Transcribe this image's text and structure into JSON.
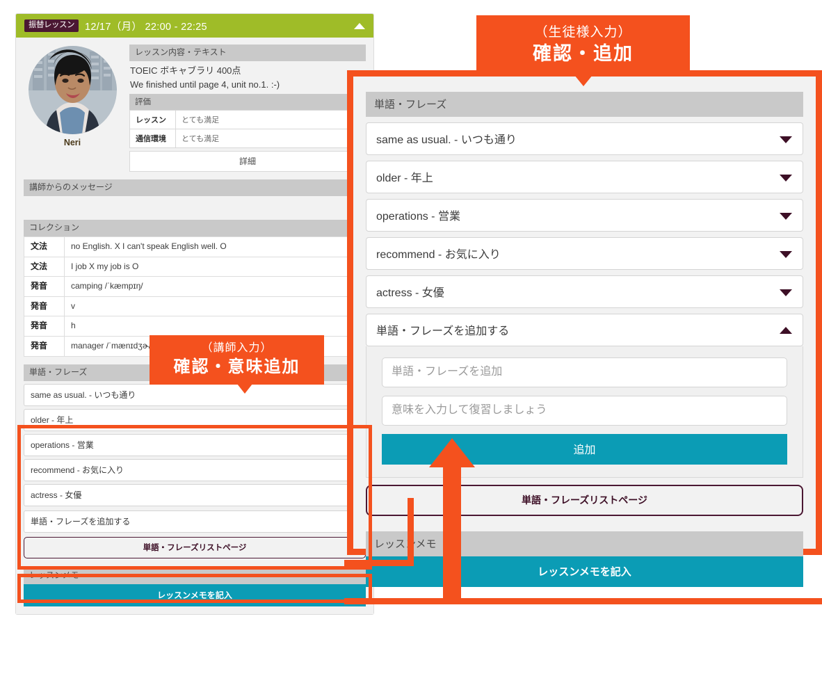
{
  "lesson_card": {
    "header": {
      "badge": "振替レッスン",
      "datetime": "12/17（月） 22:00 - 22:25",
      "collapse_icon": "caret-up-icon"
    },
    "teacher": {
      "name": "Neri",
      "avatar_icon": "teacher-avatar"
    },
    "lesson_content": {
      "section_title": "レッスン内容・テキスト",
      "line1": "TOEIC ボキャブラリ 400点",
      "line2": "We finished until page 4, unit no.1. :-)"
    },
    "evaluation": {
      "section_title": "評価",
      "rows": [
        {
          "label": "レッスン",
          "value": "とても満足"
        },
        {
          "label": "通信環境",
          "value": "とても満足"
        }
      ],
      "detail_button": "詳細"
    },
    "teacher_message": {
      "section_title": "講師からのメッセージ",
      "body": ""
    },
    "collection": {
      "section_title": "コレクション",
      "rows": [
        {
          "category": "文法",
          "text": "no English. X I can't speak English well. O"
        },
        {
          "category": "文法",
          "text": "I job X my job is O"
        },
        {
          "category": "発音",
          "text": "camping /ˈkæmpɪŋ/"
        },
        {
          "category": "発音",
          "text": "v"
        },
        {
          "category": "発音",
          "text": "h"
        },
        {
          "category": "発音",
          "text": "manager /ˈmænɪdʒɚ/"
        }
      ]
    },
    "words": {
      "section_title": "単語・フレーズ",
      "items": [
        "same as usual. - いつも通り",
        "older - 年上",
        "operations - 営業",
        "recommend - お気に入り",
        "actress - 女優"
      ],
      "add_toggle": "単語・フレーズを追加する",
      "list_page_button": "単語・フレーズリストページ"
    },
    "memo": {
      "section_title": "レッスンメモ",
      "button": "レッスンメモを記入"
    }
  },
  "detail_panel": {
    "words": {
      "section_title": "単語・フレーズ",
      "items": [
        "same as usual. - いつも通り",
        "older - 年上",
        "operations - 営業",
        "recommend - お気に入り",
        "actress - 女優"
      ],
      "add_toggle": "単語・フレーズを追加する",
      "add_form": {
        "word_placeholder": "単語・フレーズを追加",
        "word_value": "",
        "meaning_placeholder": "意味を入力して復習しましょう",
        "meaning_value": "",
        "submit_button": "追加"
      },
      "list_page_button": "単語・フレーズリストページ"
    },
    "memo": {
      "section_title": "レッスンメモ",
      "button": "レッスンメモを記入"
    }
  },
  "annotations": {
    "student_callout": {
      "line1": "（生徒様入力）",
      "line2": "確認・追加"
    },
    "teacher_callout": {
      "line1": "（講師入力）",
      "line2": "確認・意味追加"
    },
    "accent_color": "#f4511e"
  }
}
